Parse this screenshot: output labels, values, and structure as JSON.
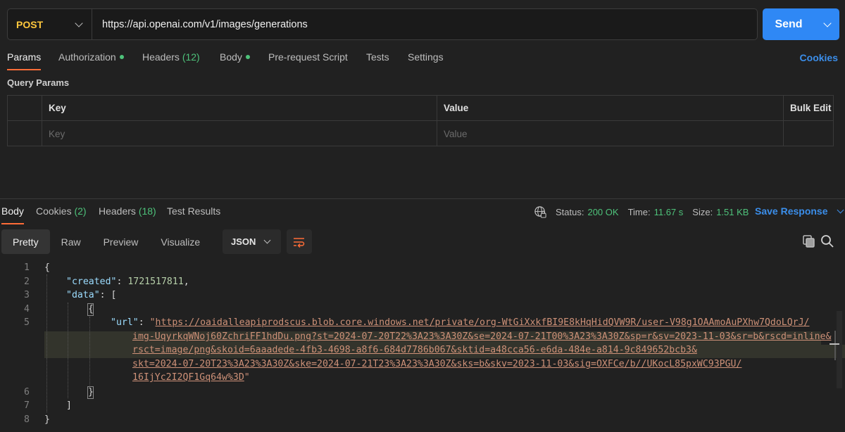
{
  "request": {
    "method": "POST",
    "url": "https://api.openai.com/v1/images/generations",
    "send_label": "Send"
  },
  "request_tabs": {
    "params": "Params",
    "authorization": "Authorization",
    "headers": "Headers",
    "headers_count": "(12)",
    "body": "Body",
    "pre_request": "Pre-request Script",
    "tests": "Tests",
    "settings": "Settings",
    "cookies": "Cookies"
  },
  "query_params": {
    "title": "Query Params",
    "col_key": "Key",
    "col_value": "Value",
    "bulk_edit": "Bulk Edit",
    "key_placeholder": "Key",
    "value_placeholder": "Value"
  },
  "response_tabs": {
    "body": "Body",
    "cookies": "Cookies",
    "cookies_count": "(2)",
    "headers": "Headers",
    "headers_count": "(18)",
    "test_results": "Test Results"
  },
  "status": {
    "status_label": "Status:",
    "status_value": "200 OK",
    "time_label": "Time:",
    "time_value": "11.67 s",
    "size_label": "Size:",
    "size_value": "1.51 KB",
    "save_response": "Save Response"
  },
  "view_tabs": {
    "pretty": "Pretty",
    "raw": "Raw",
    "preview": "Preview",
    "visualize": "Visualize",
    "format": "JSON"
  },
  "code": {
    "line_numbers": [
      "1",
      "2",
      "3",
      "4",
      "5",
      "6",
      "7",
      "8"
    ],
    "open_brace": "{",
    "created_key": "\"created\"",
    "created_value": "1721517811",
    "data_key": "\"data\"",
    "open_bracket": "[",
    "inner_open": "{",
    "url_key": "\"url\"",
    "url_lines": [
      "https://oaidalleapiprodscus.blob.core.windows.net/private/org-WtGiXxkfBI9E8kHqHidQVW9R/user-V98g1OAAmoAuPXhw7QdoLQrJ/",
      "img-UqyrkqWNoj60ZchriFF1hdDu.png?st=2024-07-20T22%3A23%3A30Z&se=2024-07-21T00%3A23%3A30Z&sp=r&sv=2023-11-03&sr=b&rscd=inline&",
      "rsct=image/png&skoid=6aaadede-4fb3-4698-a8f6-684d7786b067&sktid=a48cca56-e6da-484e-a814-9c849652bcb3&",
      "skt=2024-07-20T23%3A23%3A30Z&ske=2024-07-21T23%3A23%3A30Z&sks=b&skv=2023-11-03&sig=OXFCe/b//UKocL85pxWC93PGU/",
      "16IjYc2I2QF1Gq64w%3D"
    ],
    "inner_close": "}",
    "close_bracket": "]",
    "close_brace": "}"
  }
}
